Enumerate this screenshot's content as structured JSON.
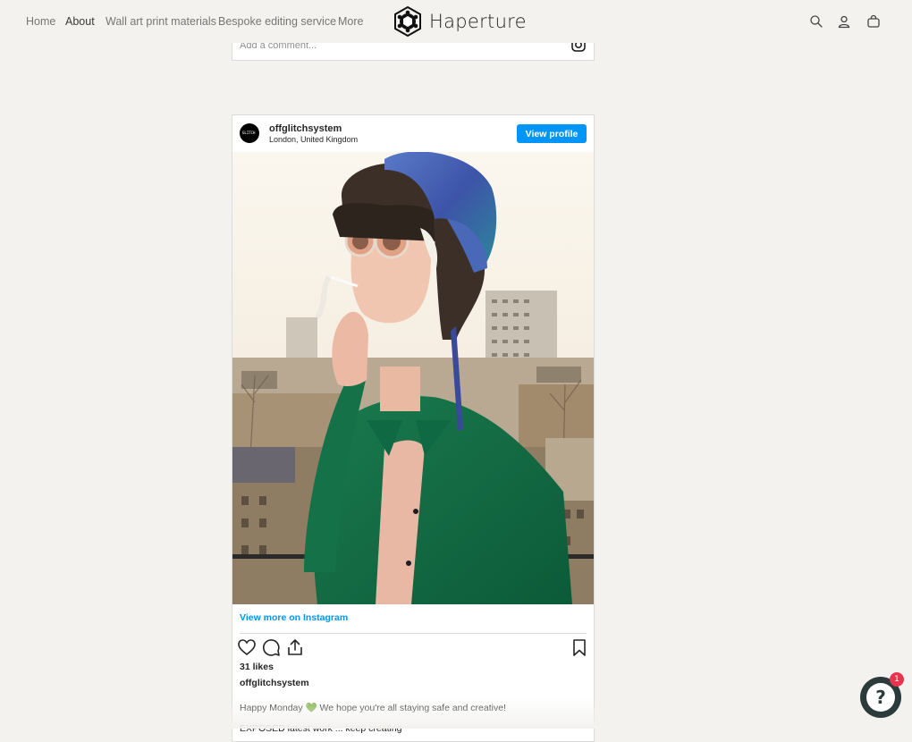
{
  "nav": {
    "links": [
      "Home",
      "About",
      "Wall art print materials",
      "Bespoke editing service",
      "More"
    ],
    "brand": "Haperture",
    "icons": [
      "search-icon",
      "account-icon",
      "cart-icon"
    ]
  },
  "embed_top": {
    "comment_placeholder": "Add a comment..."
  },
  "post": {
    "username": "offglitchsystem",
    "location": "London, United Kingdom",
    "avatar_text": "GLITCH",
    "view_profile": "View profile",
    "view_more": "View more on Instagram",
    "likes": "31 likes",
    "caption_user": "offglitchsystem",
    "caption": "Happy Monday 💚 We hope you're all staying safe and creative!",
    "caption_2": "EXPOSED latest work ... keep creating"
  },
  "help_widget": {
    "symbol": "?",
    "badge": "1"
  },
  "colors": {
    "page_bg": "#f3f2ef",
    "accent": "#0095f6",
    "badge": "#e8344e"
  }
}
